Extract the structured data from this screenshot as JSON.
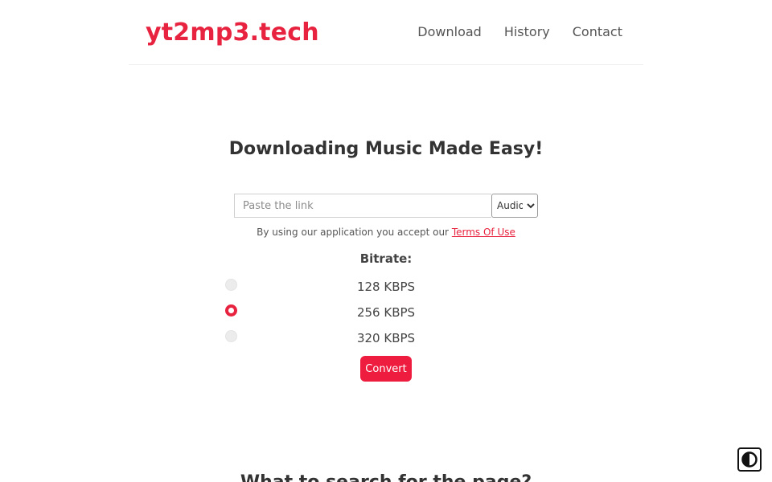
{
  "header": {
    "brand": "yt2mp3.tech",
    "nav": [
      {
        "label": "Download"
      },
      {
        "label": "History"
      },
      {
        "label": "Contact"
      }
    ]
  },
  "hero": {
    "headline": "Downloading Music Made Easy!",
    "link_placeholder": "Paste the link",
    "link_value": "",
    "format_selected": "Audio",
    "terms_text": "By using our application you accept our",
    "terms_link": "Terms Of Use"
  },
  "bitrate": {
    "title": "Bitrate:",
    "options": [
      {
        "label": "128 KBPS",
        "checked": false
      },
      {
        "label": "256 KBPS",
        "checked": true
      },
      {
        "label": "320 KBPS",
        "checked": false
      }
    ]
  },
  "convert_label": "Convert",
  "next_section_heading": "What to search for the page?",
  "icons": {
    "contrast_toggle": "contrast-icon"
  },
  "colors": {
    "brand": "#e8233f",
    "button": "#ee1c3f"
  }
}
